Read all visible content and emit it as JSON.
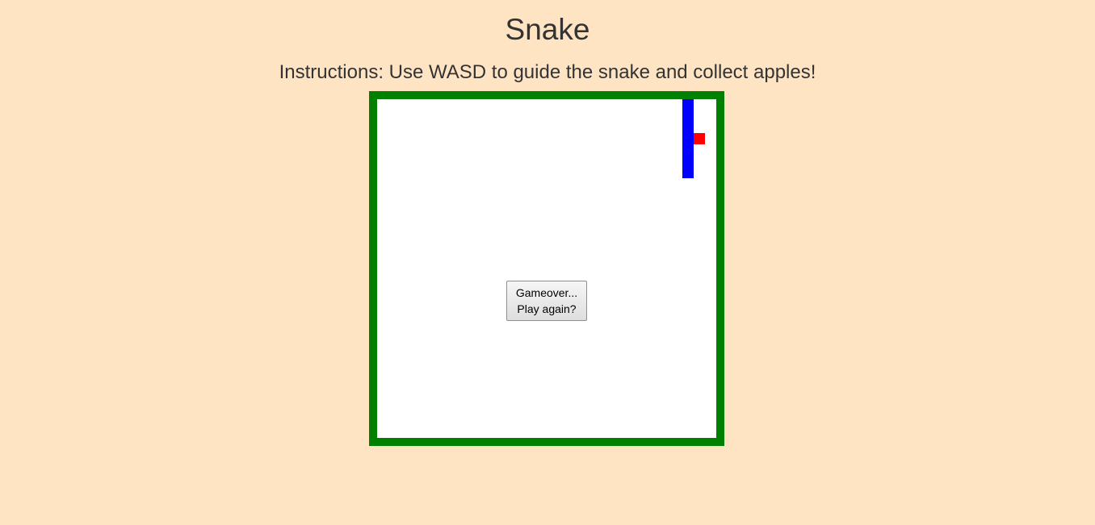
{
  "page": {
    "title": "Snake",
    "instructions": "Instructions: Use WASD to guide the snake and collect apples!"
  },
  "game": {
    "state": "gameover",
    "replay_button": {
      "line1": "Gameover...",
      "line2": "Play again?"
    },
    "colors": {
      "background": "#ffe4c4",
      "border": "#008000",
      "board": "#ffffff",
      "snake": "#0000ff",
      "apple": "#ff0000"
    }
  }
}
